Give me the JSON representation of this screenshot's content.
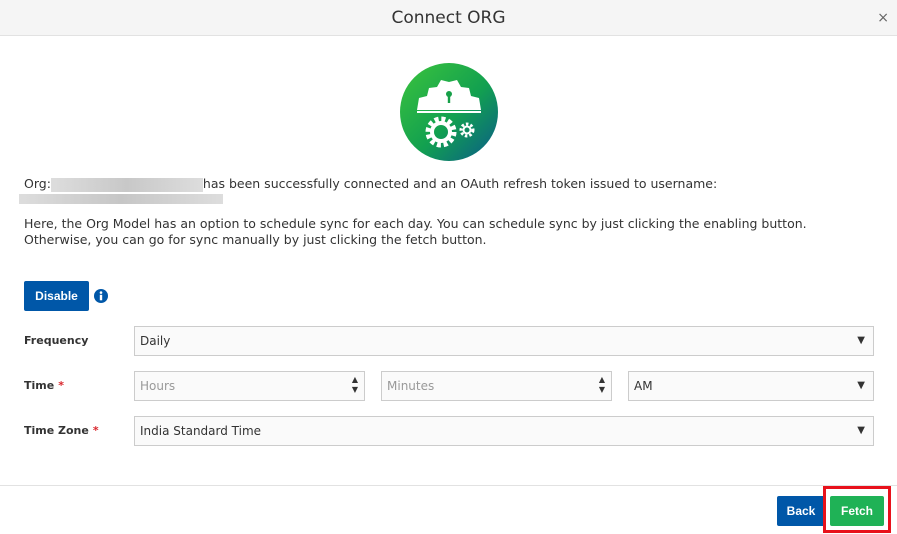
{
  "dialog": {
    "title": "Connect ORG",
    "close": "×"
  },
  "message": {
    "org_prefix": "Org:",
    "connected_text": "has been successfully connected and an OAuth refresh token issued to username:",
    "line1": "Here, the Org Model has an option to schedule sync for each day. You can schedule sync by just clicking the enabling button.",
    "line2": "Otherwise, you can go for sync manually by just clicking the fetch button."
  },
  "disable_button": "Disable",
  "form": {
    "frequency_label": "Frequency",
    "frequency_value": "Daily",
    "time_label": "Time",
    "required": "*",
    "hours_placeholder": "Hours",
    "minutes_placeholder": "Minutes",
    "ampm_value": "AM",
    "timezone_label": "Time Zone",
    "timezone_value": "India Standard Time"
  },
  "footer": {
    "back": "Back",
    "fetch": "Fetch"
  },
  "colors": {
    "primary": "#0057a8",
    "success": "#1fb256",
    "highlight": "#e8111b"
  }
}
